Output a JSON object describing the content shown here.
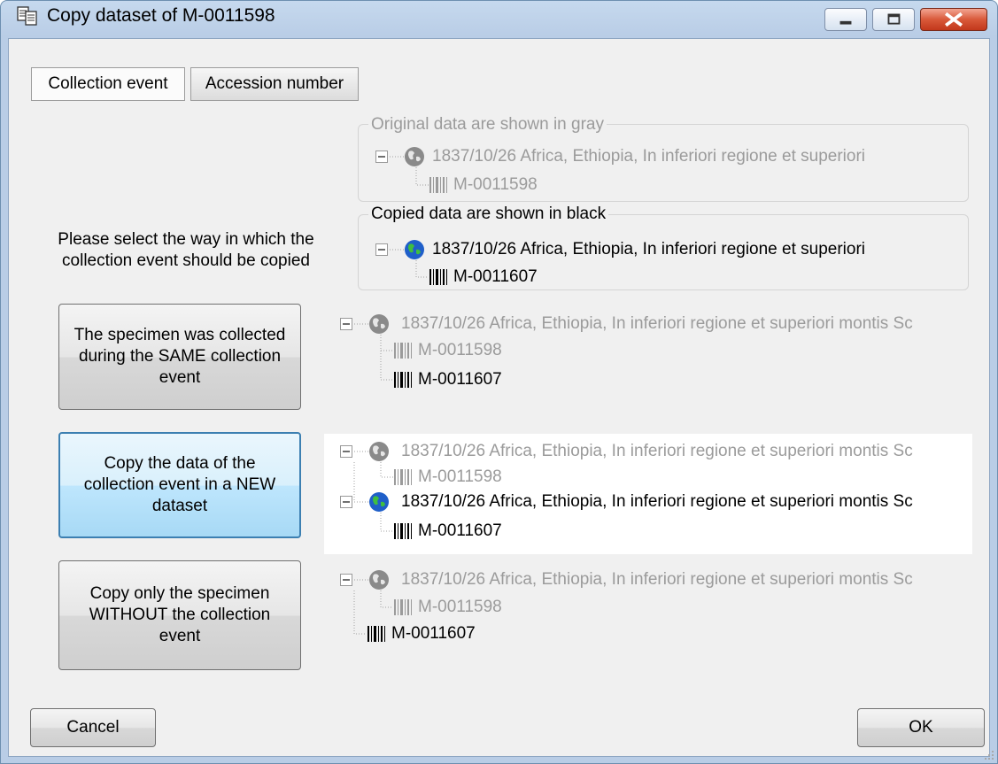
{
  "window": {
    "title": "Copy dataset of M-0011598",
    "controls": [
      "minimize",
      "maximize",
      "close"
    ]
  },
  "tabs": [
    {
      "label": "Collection event",
      "active": true
    },
    {
      "label": "Accession number",
      "active": false
    }
  ],
  "original_group": {
    "label": "Original data are shown in gray",
    "event_text": "1837/10/26 Africa, Ethiopia, In inferiori regione et superiori",
    "specimen_text": "M-0011598"
  },
  "copied_group": {
    "label": "Copied data are shown in black",
    "event_text": "1837/10/26 Africa, Ethiopia, In inferiori regione et superiori",
    "specimen_text": "M-0011607"
  },
  "prompt": "Please select the way in which the collection event should be copied",
  "options": [
    {
      "button_label": "The specimen was collected during the SAME collection event",
      "tree": {
        "event_text": "1837/10/26 Africa, Ethiopia, In inferiori regione et superiori montis Sc",
        "original_specimen": "M-0011598",
        "copied_specimen": "M-0011607"
      }
    },
    {
      "button_label": "Copy the data of the collection event in a NEW dataset",
      "tree": {
        "event_text": "1837/10/26 Africa, Ethiopia, In inferiori regione et superiori montis Sc",
        "original_specimen": "M-0011598",
        "copied_event_text": "1837/10/26 Africa, Ethiopia, In inferiori regione et superiori montis Sc",
        "copied_specimen": "M-0011607"
      }
    },
    {
      "button_label": "Copy only the specimen WITHOUT the collection event",
      "tree": {
        "event_text": "1837/10/26 Africa, Ethiopia, In inferiori regione et superiori montis Sc",
        "original_specimen": "M-0011598",
        "copied_specimen": "M-0011607"
      }
    }
  ],
  "footer": {
    "cancel_label": "Cancel",
    "ok_label": "OK"
  },
  "icons": {
    "title": "copy-dataset-icon",
    "event": "globe-icon",
    "specimen": "barcode-icon",
    "tree_toggle": "collapse-minus-icon"
  },
  "colors": {
    "original_text": "#9b9b9b",
    "copied_text": "#000000",
    "close_button": "#c2381b",
    "focus_border": "#3c7fb1"
  }
}
